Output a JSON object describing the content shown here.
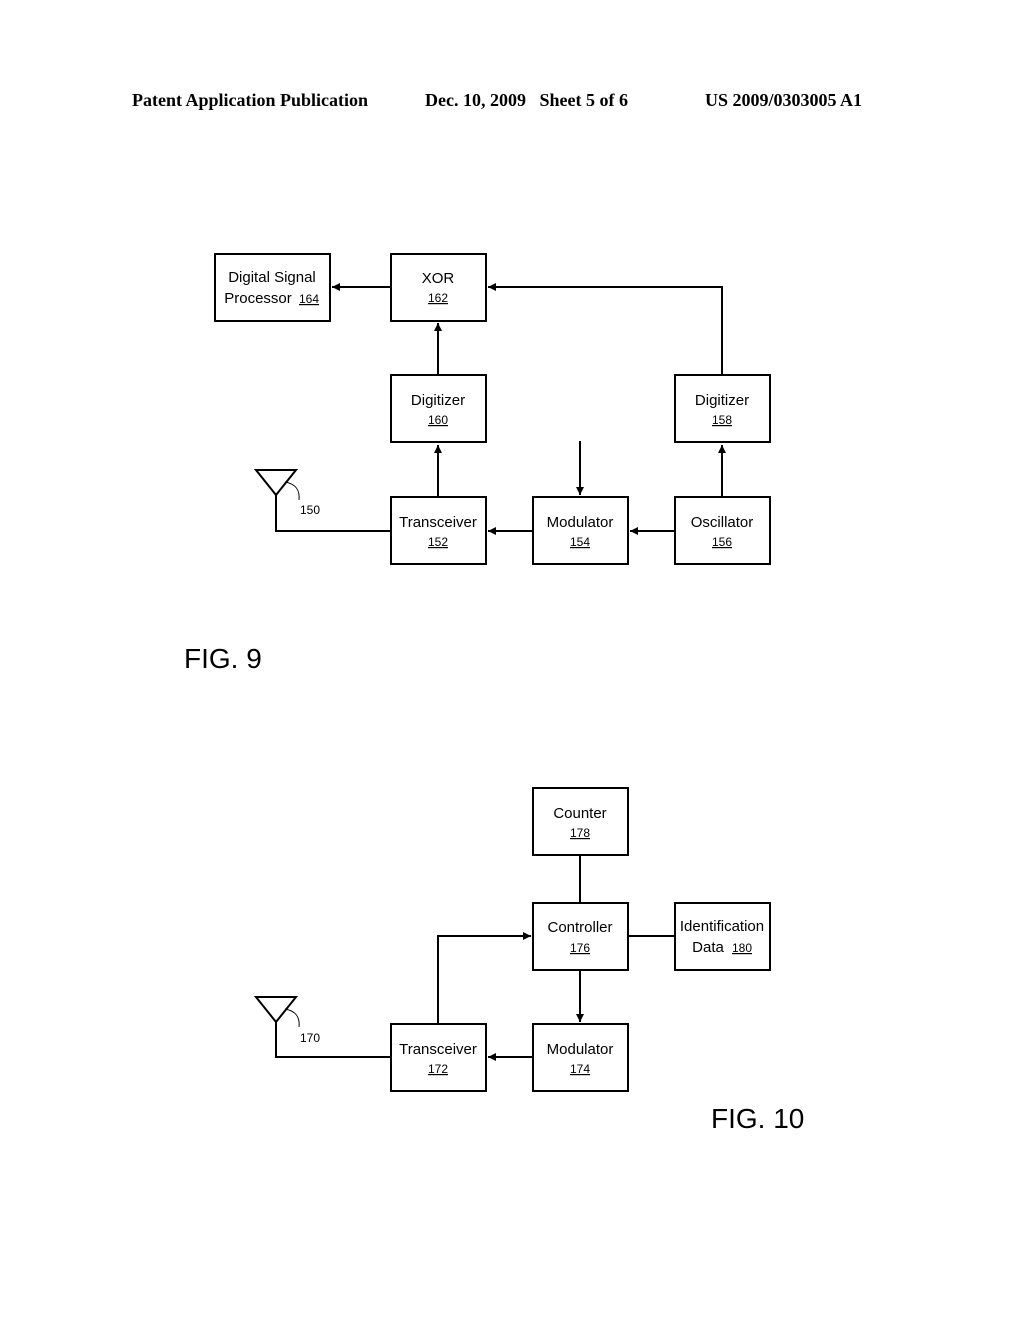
{
  "header": {
    "left": "Patent Application Publication",
    "middle": "Dec. 10, 2009   Sheet 5 of 6",
    "right": "US 2009/0303005 A1"
  },
  "fig9": {
    "label": "FIG. 9",
    "antenna_ref": "150",
    "dsp": {
      "line1": "Digital Signal",
      "line2": "Processor",
      "ref": "164"
    },
    "xor": {
      "name": "XOR",
      "ref": "162"
    },
    "digitizer_a": {
      "name": "Digitizer",
      "ref": "160"
    },
    "digitizer_b": {
      "name": "Digitizer",
      "ref": "158"
    },
    "transceiver": {
      "name": "Transceiver",
      "ref": "152"
    },
    "modulator": {
      "name": "Modulator",
      "ref": "154"
    },
    "oscillator": {
      "name": "Oscillator",
      "ref": "156"
    }
  },
  "fig10": {
    "label": "FIG. 10",
    "antenna_ref": "170",
    "counter": {
      "name": "Counter",
      "ref": "178"
    },
    "controller": {
      "name": "Controller",
      "ref": "176"
    },
    "id_data": {
      "line1": "Identification",
      "line2": "Data",
      "ref": "180"
    },
    "transceiver": {
      "name": "Transceiver",
      "ref": "172"
    },
    "modulator": {
      "name": "Modulator",
      "ref": "174"
    }
  }
}
